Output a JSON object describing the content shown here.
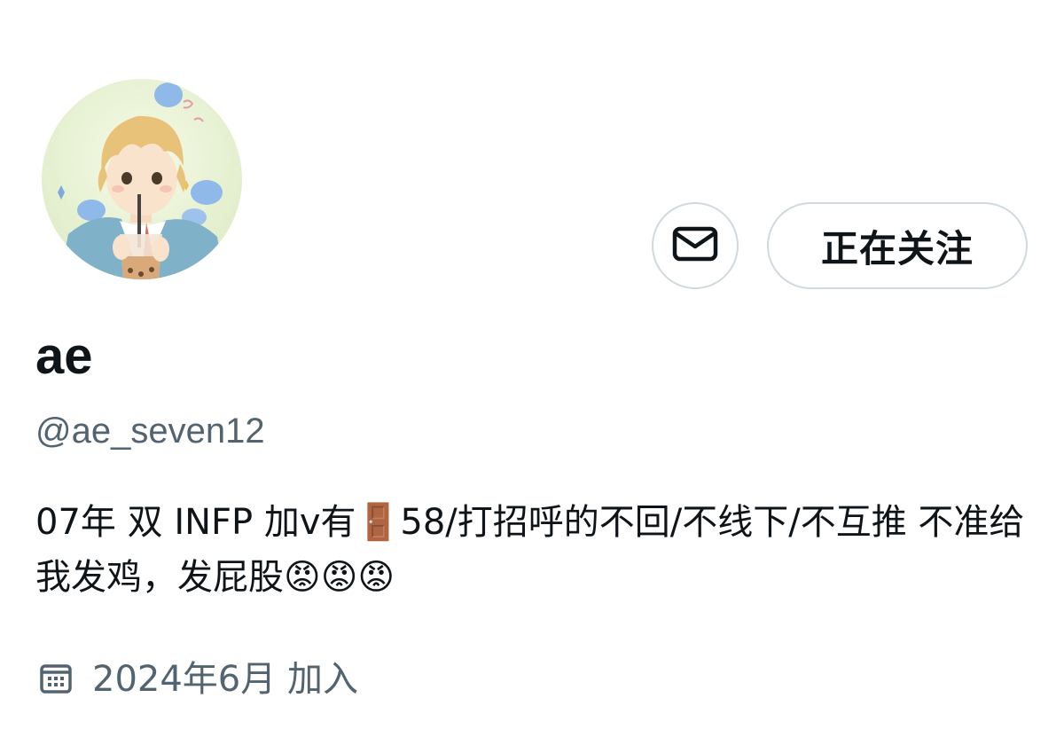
{
  "profile": {
    "display_name": "ae",
    "handle": "@ae_seven12",
    "bio": "07年 双 INFP 加v有🚪58/打招呼的不回/不线下/不互推 不准给我发鸡，发屁股😡😡😡",
    "joined": "2024年6月 加入"
  },
  "actions": {
    "message_icon": "mail-icon",
    "follow_label": "正在关注"
  },
  "icons": {
    "joined": "calendar-icon"
  },
  "colors": {
    "text_primary": "#0f1419",
    "text_secondary": "#536471",
    "border": "#cfd9de"
  }
}
